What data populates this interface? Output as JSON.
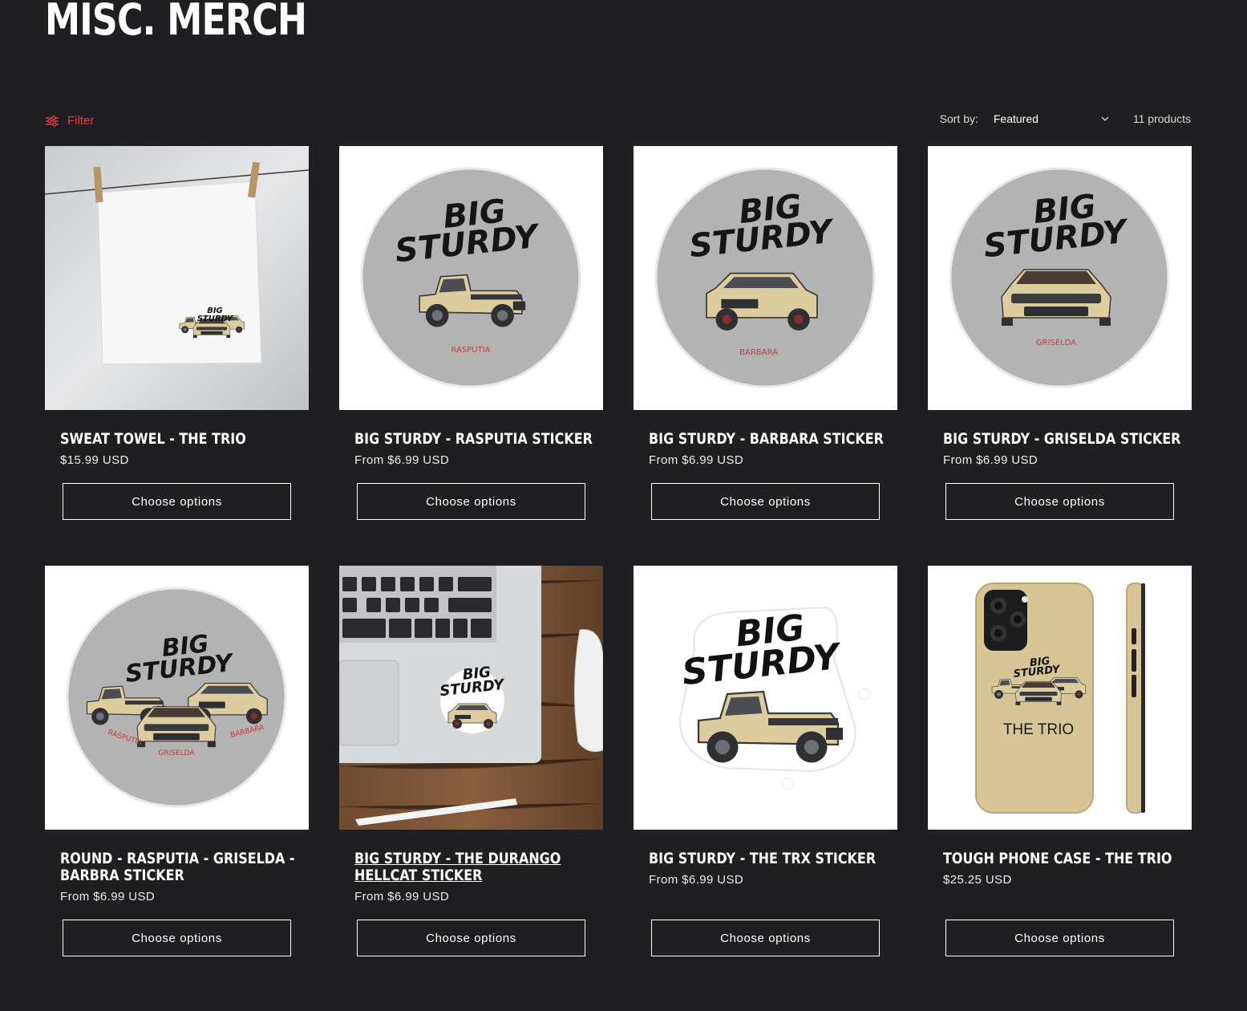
{
  "page": {
    "title": "MISC. MERCH"
  },
  "toolbar": {
    "filter_label": "Filter",
    "sort_label": "Sort by:",
    "sort_value": "Featured",
    "product_count": "11 products"
  },
  "products": [
    {
      "title": "SWEAT TOWEL - THE TRIO",
      "price": "$15.99 USD",
      "button": "Choose options"
    },
    {
      "title": "BIG STURDY - RASPUTIA STICKER",
      "price": "From $6.99 USD",
      "button": "Choose options",
      "sticker_name": "RASPUTIA"
    },
    {
      "title": "BIG STURDY - BARBARA STICKER",
      "price": "From $6.99 USD",
      "button": "Choose options",
      "sticker_name": "BARBARA"
    },
    {
      "title": "BIG STURDY - GRISELDA STICKER",
      "price": "From $6.99 USD",
      "button": "Choose options",
      "sticker_name": "GRISELDA"
    },
    {
      "title": "ROUND - RASPUTIA - GRISELDA - BARBRA STICKER",
      "price": "From $6.99 USD",
      "button": "Choose options",
      "sticker_names": [
        "RASPUTIA",
        "GRISELDA",
        "BARBARA"
      ]
    },
    {
      "title": "BIG STURDY - THE DURANGO HELLCAT STICKER",
      "price": "From $6.99 USD",
      "button": "Choose options"
    },
    {
      "title": "BIG STURDY - THE TRX STICKER",
      "price": "From $6.99 USD",
      "button": "Choose options"
    },
    {
      "title": "TOUGH PHONE CASE - THE TRIO",
      "price": "$25.25 USD",
      "button": "Choose options",
      "case_text": "THE TRIO"
    }
  ],
  "artwork": {
    "logo_line1": "BIG",
    "logo_line2": "STURDY"
  },
  "colors": {
    "background": "#1f1f22",
    "accent": "#e53a3a",
    "sticker_gray": "#b3b3b3",
    "truck_tan": "#dccc9e",
    "case_tan": "#d7c595"
  }
}
